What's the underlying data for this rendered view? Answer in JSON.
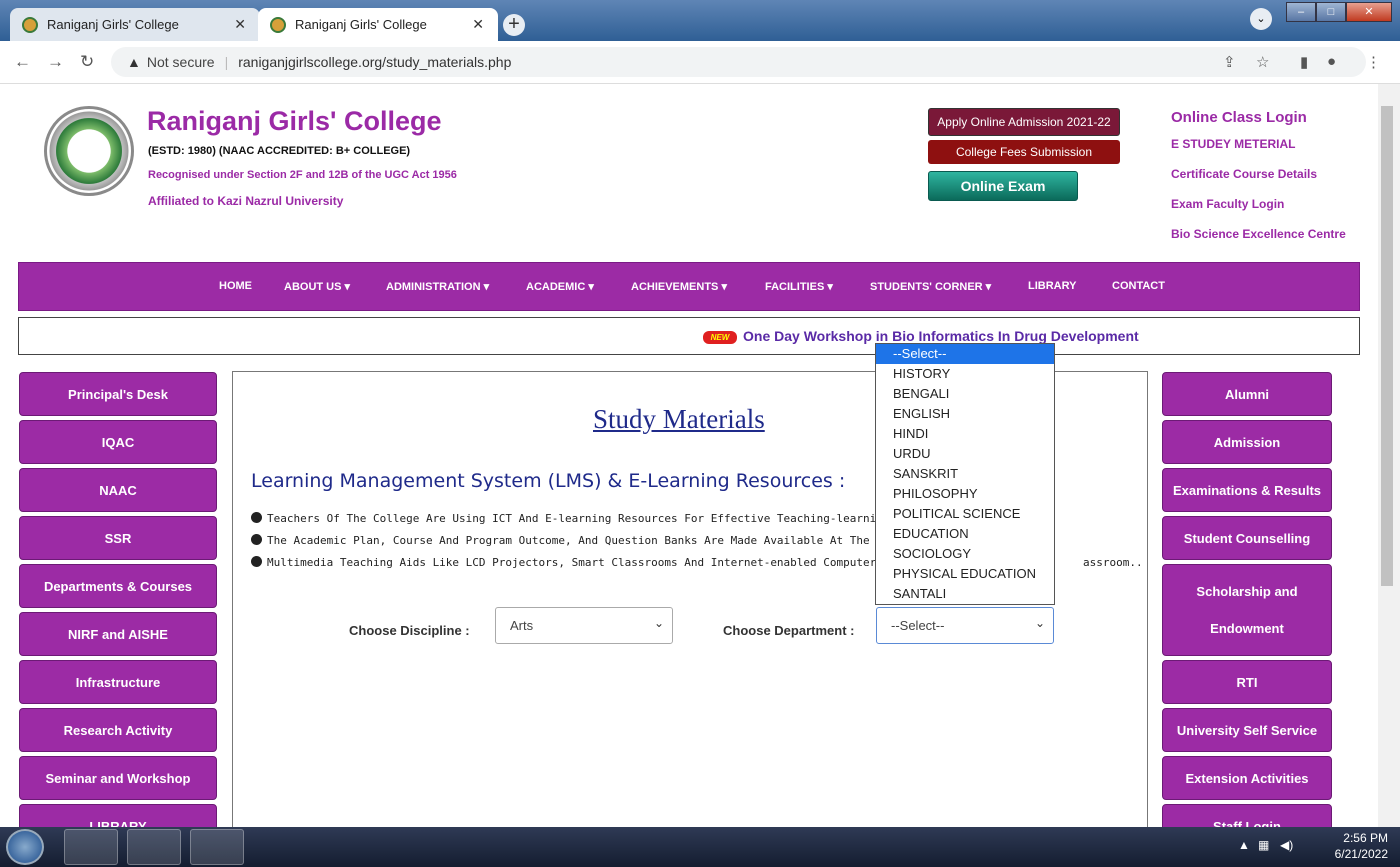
{
  "browser": {
    "tabs": [
      {
        "title": "Raniganj Girls' College"
      },
      {
        "title": "Raniganj Girls' College"
      }
    ],
    "new_tab": "+",
    "address": {
      "security": "Not secure",
      "url": "raniganjgirlscollege.org/study_materials.php"
    }
  },
  "header": {
    "college_name": "Raniganj Girls' College",
    "estd": "(ESTD: 1980) (NAAC ACCREDITED: B+ COLLEGE)",
    "recognised": "Recognised under Section 2F and 12B of the UGC Act 1956",
    "affiliated": "Affiliated to Kazi Nazrul University",
    "buttons": {
      "apply": "Apply Online Admission 2021-22",
      "fees": "College Fees Submission",
      "exam": "Online Exam"
    },
    "right_links": {
      "online_class": "Online Class Login",
      "e_study": "E STUDEY METERIAL",
      "certificate": "Certificate Course Details",
      "faculty": "Exam Faculty Login",
      "bioscience": "Bio Science Excellence Centre"
    }
  },
  "nav": {
    "home": "HOME",
    "about": "ABOUT US ▾",
    "administration": "ADMINISTRATION ▾",
    "academic": "ACADEMIC ▾",
    "achievements": "ACHIEVEMENTS ▾",
    "facilities": "FACILITIES ▾",
    "students": "STUDENTS' CORNER ▾",
    "library": "LIBRARY",
    "contact": "CONTACT"
  },
  "marquee": {
    "badge": "NEW",
    "text": "One Day Workshop in Bio Informatics In Drug Development"
  },
  "left_menu": [
    "Principal's Desk",
    "IQAC",
    "NAAC",
    "SSR",
    "Departments & Courses",
    "NIRF and AISHE",
    "Infrastructure",
    "Research Activity",
    "Seminar and Workshop",
    "LIBRARY"
  ],
  "right_menu": [
    "Alumni",
    "Admission",
    "Examinations & Results",
    "Student Counselling",
    "Scholarship and",
    "Endowment",
    "RTI",
    "University Self Service",
    "Extension Activities",
    "Staff Login"
  ],
  "content": {
    "title": "Study Materials",
    "lms_heading": "Learning Management System (LMS) & E-Learning Resources :",
    "bullets": [
      "Teachers Of The College Are Using ICT And E-learning Resources For Effective Teaching-learning.",
      "The Academic Plan, Course And Program Outcome, And Question Banks Are Made Available At The Very",
      "Multimedia Teaching Aids Like LCD Projectors, Smart Classrooms And Internet-enabled Computer Syste"
    ],
    "bullet3_tail": "assroom..",
    "discipline_label": "Choose Discipline :",
    "discipline_value": "Arts",
    "department_label": "Choose Department :",
    "department_value": "--Select--"
  },
  "dropdown_options": [
    "--Select--",
    "HISTORY",
    "BENGALI",
    "ENGLISH",
    "HINDI",
    "URDU",
    "SANSKRIT",
    "PHILOSOPHY",
    "POLITICAL SCIENCE",
    "EDUCATION",
    "SOCIOLOGY",
    "PHYSICAL EDUCATION",
    "SANTALI"
  ],
  "taskbar": {
    "time": "2:56 PM",
    "date": "6/21/2022"
  },
  "colors": {
    "brand": "#9c2ba5",
    "title_blue": "#1f2a8a",
    "select_highlight": "#1e74e8"
  }
}
